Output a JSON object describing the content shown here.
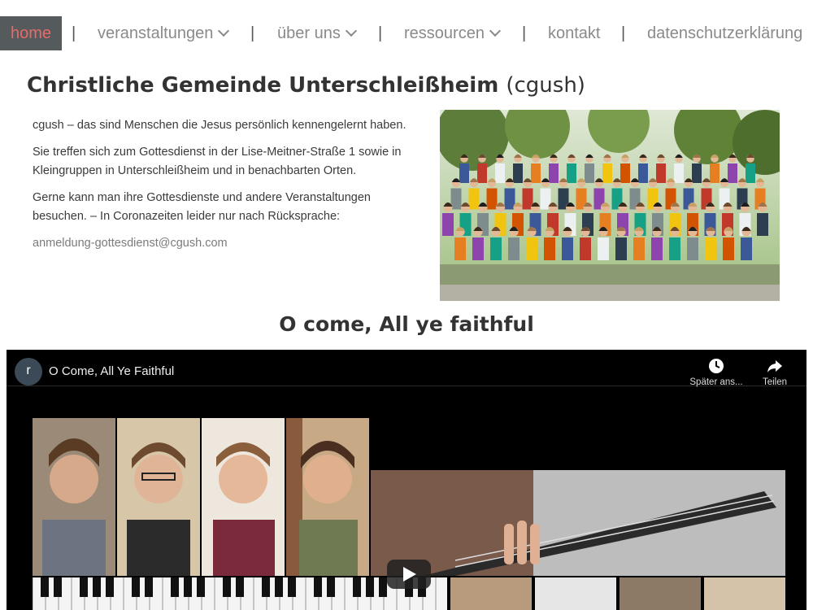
{
  "nav": {
    "items": [
      {
        "label": "home",
        "active": true
      },
      {
        "label": "veranstaltungen",
        "dropdown": true
      },
      {
        "label": "über uns",
        "dropdown": true
      },
      {
        "label": "ressourcen",
        "dropdown": true
      },
      {
        "label": "kontakt"
      },
      {
        "label": "datenschutzerklärung"
      }
    ],
    "separator": "|"
  },
  "header": {
    "title": "Christliche Gemeinde Unterschleißheim",
    "abbr": "(cgush)"
  },
  "intro": {
    "p1": "cgush – das sind Menschen die Jesus persönlich kennengelernt haben.",
    "p2": "Sie treffen sich zum Gottesdienst in der Lise-Meitner-Straße 1 sowie in Kleingruppen in Unterschleißheim und in benachbarten Orten.",
    "p3": "Gerne kann man ihre Gottesdienste und andere Veranstaltungen besuchen. – In Coronazeiten leider nur nach Rücksprache:",
    "email": "anmeldung-gottesdienst@cgush.com"
  },
  "song_heading": "O come, All ye faithful",
  "video": {
    "channel_initial": "r",
    "title": "O Come, All Ye Faithful",
    "watch_later": "Später ans...",
    "share": "Teilen"
  },
  "colors": {
    "nav_active_bg": "#555a5c",
    "nav_active_text": "#e86a6a",
    "nav_text": "#8a8a8a"
  }
}
